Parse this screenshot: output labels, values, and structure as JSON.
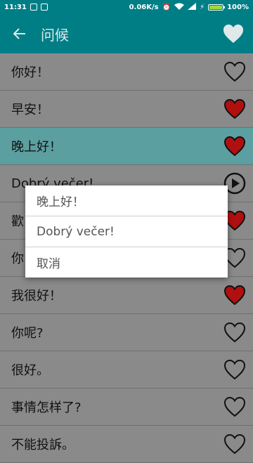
{
  "status_bar": {
    "time": "11:31",
    "net_speed": "0.06K/s",
    "battery": "100%"
  },
  "app_bar": {
    "title": "问候",
    "back_icon": "arrow-left-icon",
    "favorite_icon": "heart-icon"
  },
  "phrases": [
    {
      "text": "你好！",
      "action": "heart",
      "favorited": false
    },
    {
      "text": "早安！",
      "action": "heart",
      "favorited": true
    },
    {
      "text": "晚上好！",
      "action": "heart",
      "favorited": true,
      "highlighted": true
    },
    {
      "text": "Dobrý večer!",
      "action": "play"
    },
    {
      "text": "歡",
      "action": "heart",
      "favorited": true
    },
    {
      "text": "你",
      "action": "heart",
      "favorited": false
    },
    {
      "text": "我很好！",
      "action": "heart",
      "favorited": true
    },
    {
      "text": "你呢?",
      "action": "heart",
      "favorited": false
    },
    {
      "text": "很好。",
      "action": "heart",
      "favorited": false
    },
    {
      "text": "事情怎样了?",
      "action": "heart",
      "favorited": false
    },
    {
      "text": "不能投訴。",
      "action": "heart",
      "favorited": false
    }
  ],
  "dialog": {
    "options": [
      "晚上好！",
      "Dobrý večer!",
      "取消"
    ]
  },
  "colors": {
    "primary": "#007e86",
    "highlight_row": "#5c9fa1",
    "dim_background": "#8a8a8a",
    "heart_fill": "#b01010"
  }
}
